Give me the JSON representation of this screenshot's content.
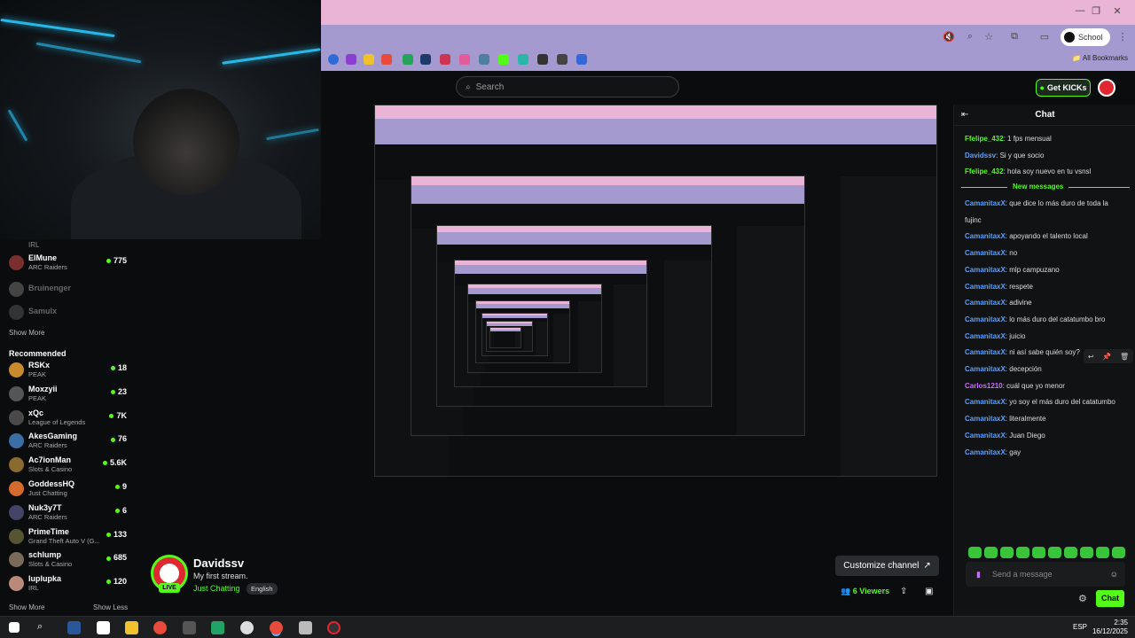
{
  "browser": {
    "profile_label": "School",
    "all_bookmarks": "All Bookmarks"
  },
  "header": {
    "search_placeholder": "Search",
    "get_kicks_label": "Get KICKs"
  },
  "sidebar": {
    "top_item_game": "IRL",
    "following": [
      {
        "name": "ElMune",
        "game": "ARC Raiders",
        "viewers": "775",
        "live": true
      },
      {
        "name": "Bruinenger",
        "game": "",
        "viewers": "",
        "live": false
      },
      {
        "name": "Samulx",
        "game": "",
        "viewers": "",
        "live": false
      }
    ],
    "show_more_1": "Show More",
    "recommended_title": "Recommended",
    "recommended": [
      {
        "name": "RSKx",
        "game": "PEAK",
        "viewers": "18"
      },
      {
        "name": "Moxzyii",
        "game": "PEAK",
        "viewers": "23"
      },
      {
        "name": "xQc",
        "game": "League of Legends",
        "viewers": "7K"
      },
      {
        "name": "AkesGaming",
        "game": "ARC Raiders",
        "viewers": "76"
      },
      {
        "name": "Ac7ionMan",
        "game": "Slots & Casino",
        "viewers": "5.6K"
      },
      {
        "name": "GoddessHQ",
        "game": "Just Chatting",
        "viewers": "9"
      },
      {
        "name": "Nuk3y7T",
        "game": "ARC Raiders",
        "viewers": "6"
      },
      {
        "name": "PrimeTime",
        "game": "Grand Theft Auto V (G...",
        "viewers": "133"
      },
      {
        "name": "schlump",
        "game": "Slots & Casino",
        "viewers": "685"
      },
      {
        "name": "luplupka",
        "game": "IRL",
        "viewers": "120"
      }
    ],
    "show_more_2": "Show More",
    "show_less": "Show Less"
  },
  "stream": {
    "channel": "Davidssv",
    "title": "My first stream.",
    "category": "Just Chatting",
    "language": "English",
    "live_badge": "LIVE",
    "customize_label": "Customize channel",
    "viewers_label": "6 Viewers"
  },
  "chat": {
    "title": "Chat",
    "new_messages": "New messages",
    "messages_before": [
      {
        "user": "Ffelipe_432",
        "text": "1 fps mensual",
        "color": "green"
      },
      {
        "user": "Davidssv",
        "text": "Si y que socio",
        "color": "blue"
      },
      {
        "user": "Ffelipe_432",
        "text": "hola soy nuevo en tu vsnsl",
        "color": "green"
      }
    ],
    "messages_after": [
      {
        "user": "CamanitaxX",
        "text": "que dice lo más duro de toda la",
        "color": "blue"
      },
      {
        "user": "",
        "text": "fujinc",
        "color": "blue"
      },
      {
        "user": "CamanitaxX",
        "text": "apoyando el talento local",
        "color": "blue"
      },
      {
        "user": "CamanitaxX",
        "text": "no",
        "color": "blue"
      },
      {
        "user": "CamanitaxX",
        "text": "mlp campuzano",
        "color": "blue"
      },
      {
        "user": "CamanitaxX",
        "text": "respete",
        "color": "blue"
      },
      {
        "user": "CamanitaxX",
        "text": "adivine",
        "color": "blue"
      },
      {
        "user": "CamanitaxX",
        "text": "lo más duro del catatumbo bro",
        "color": "blue"
      },
      {
        "user": "CamanitaxX",
        "text": "juicio",
        "color": "blue"
      },
      {
        "user": "CamanitaxX",
        "text": "ni así sabe quién soy?",
        "color": "blue"
      },
      {
        "user": "CamanitaxX",
        "text": "decepción",
        "color": "blue"
      },
      {
        "user": "Carlos1210",
        "text": "cuál que yo menor",
        "color": "purple"
      },
      {
        "user": "CamanitaxX",
        "text": "yo soy el más duro del catatumbo",
        "color": "blue"
      },
      {
        "user": "CamanitaxX",
        "text": "literalmente",
        "color": "blue"
      },
      {
        "user": "CamanitaxX",
        "text": "Juan Diego",
        "color": "blue"
      },
      {
        "user": "CamanitaxX",
        "text": "gay",
        "color": "blue"
      }
    ],
    "input_placeholder": "Send a message",
    "send_label": "Chat"
  },
  "taskbar": {
    "language": "ESP",
    "time": "2:35",
    "date": "16/12/2025"
  },
  "colors": {
    "accent": "#53fc18",
    "titlebar": "#e9b4d6",
    "toolbar": "#a59ad0",
    "background": "#0b0c0d",
    "username_blue": "#5aa0ff",
    "username_purple": "#c86cff"
  }
}
